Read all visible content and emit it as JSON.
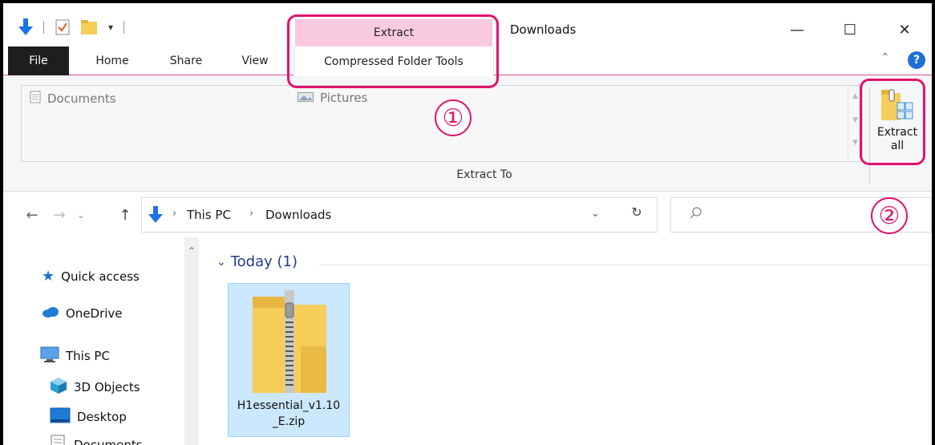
{
  "window": {
    "title": "Downloads",
    "minimize_glyph": "—",
    "maximize_glyph": "☐",
    "close_glyph": "✕"
  },
  "quick_access_toolbar": {
    "dropdown_glyph": "▾"
  },
  "ribbon": {
    "context_tab_header": "Extract",
    "tabs": [
      {
        "label": "File"
      },
      {
        "label": "Home"
      },
      {
        "label": "Share"
      },
      {
        "label": "View"
      },
      {
        "label": "Compressed Folder Tools"
      }
    ],
    "gallery_items": [
      {
        "label": "Documents",
        "icon": "document-icon"
      },
      {
        "label": "Pictures",
        "icon": "pictures-icon"
      }
    ],
    "group_label": "Extract To",
    "extract_all_label_line1": "Extract",
    "extract_all_label_line2": "all"
  },
  "navigation": {
    "breadcrumb": [
      {
        "label": "This PC"
      },
      {
        "label": "Downloads"
      }
    ],
    "search_placeholder": ""
  },
  "nav_pane": {
    "items": [
      {
        "label": "Quick access",
        "icon": "star-icon"
      },
      {
        "label": "OneDrive",
        "icon": "cloud-icon"
      },
      {
        "label": "This PC",
        "icon": "computer-icon"
      },
      {
        "label": "3D Objects",
        "icon": "cube-icon"
      },
      {
        "label": "Desktop",
        "icon": "desktop-icon"
      },
      {
        "label": "Documents",
        "icon": "document-icon"
      }
    ]
  },
  "content": {
    "group_header": "Today (1)",
    "files": [
      {
        "name_line1": "H1essential_v1.10",
        "name_line2": "_E.zip",
        "icon": "zip-folder-icon"
      }
    ]
  },
  "annotations": [
    {
      "number": "①"
    },
    {
      "number": "②"
    }
  ],
  "colors": {
    "accent_pink": "#e0136f",
    "context_tab_pink": "#f9c9e0",
    "selection_blue": "#cce8ff",
    "group_header_blue": "#1e3c8e",
    "download_arrow_blue": "#1a73e8"
  }
}
